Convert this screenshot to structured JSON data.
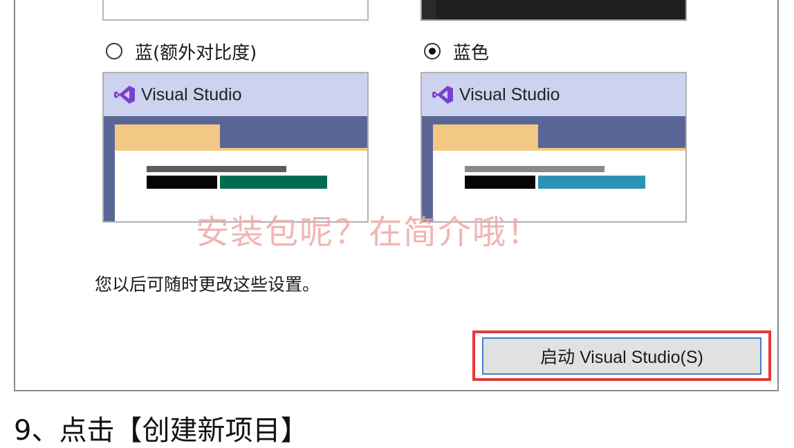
{
  "themes": {
    "blue_extra_contrast": {
      "label": "蓝(额外对比度)",
      "selected": false,
      "preview_title": "Visual Studio",
      "accent_color": "#006b52",
      "grey_bar_color": "#5c5c5c"
    },
    "blue": {
      "label": "蓝色",
      "selected": true,
      "preview_title": "Visual Studio",
      "accent_color": "#2d93b5",
      "grey_bar_color": "#8a8a8a"
    }
  },
  "colors": {
    "titlebar": "#cdd3ee",
    "toolbar": "#5a6796",
    "tab": "#f3c884",
    "vs_logo": "#7b3fd0",
    "highlight_border": "#e53935",
    "button_focus_border": "#3c7fd1"
  },
  "watermark": "安装包呢？在简介哦！",
  "note": "您以后可随时更改这些设置。",
  "launch_button_label": "启动 Visual Studio(S)",
  "step_caption": "9、点击【创建新项目】",
  "icons": {
    "vs_logo": "visual-studio-logo-icon"
  }
}
